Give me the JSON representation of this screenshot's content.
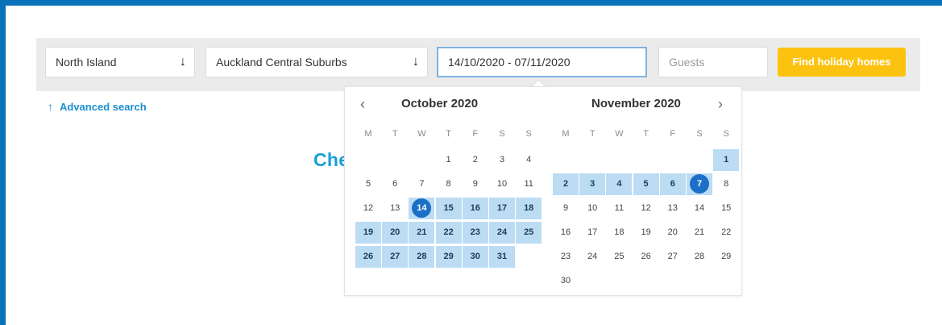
{
  "search": {
    "region": "North Island",
    "area": "Auckland Central Suburbs",
    "dates": "14/10/2020 - 07/11/2020",
    "guests_placeholder": "Guests",
    "find_button": "Find holiday homes",
    "advanced_link": "Advanced search"
  },
  "background_heading_visible": "Che",
  "calendar": {
    "prev_icon": "chevron-left-icon",
    "next_icon": "chevron-right-icon",
    "weekdays": [
      "M",
      "T",
      "W",
      "T",
      "F",
      "S",
      "S"
    ],
    "months": [
      {
        "title": "October 2020",
        "first_weekday": 3,
        "days": 31,
        "range_from": 14,
        "range_to": 31,
        "selected": 14
      },
      {
        "title": "November 2020",
        "first_weekday": 6,
        "days": 30,
        "range_from": 1,
        "range_to": 7,
        "selected": 7
      }
    ]
  },
  "colors": {
    "frame": "#0a72b9",
    "accent_button": "#fbc30f",
    "range": "#bcdcf4",
    "selected": "#1c6fc6",
    "link": "#1a8fd0"
  }
}
